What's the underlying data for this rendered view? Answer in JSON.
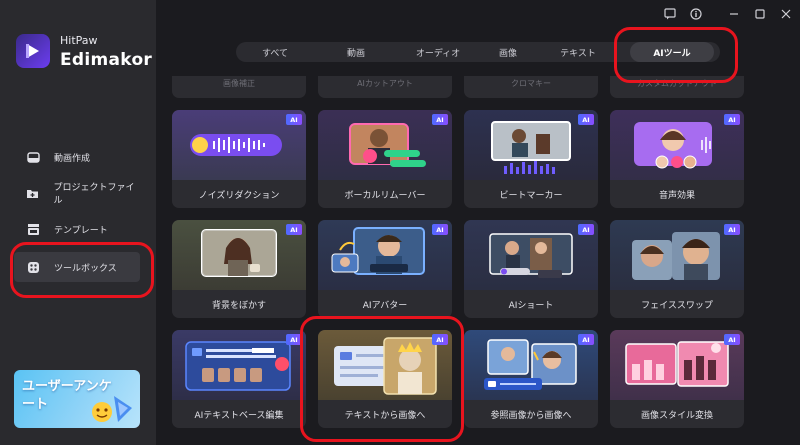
{
  "brand": {
    "line1": "HitPaw",
    "line2": "Edimakor"
  },
  "sidebar": {
    "items": [
      {
        "label": "動画作成",
        "icon": "home-icon"
      },
      {
        "label": "プロジェクトファイル",
        "icon": "folder-icon"
      },
      {
        "label": "テンプレート",
        "icon": "template-icon"
      },
      {
        "label": "ツールボックス",
        "icon": "toolbox-icon",
        "active": true
      }
    ],
    "promo": {
      "text": "ユーザーアンケート"
    }
  },
  "tabs": [
    {
      "label": "すべて"
    },
    {
      "label": "動画"
    },
    {
      "label": "オーディオ"
    },
    {
      "label": "画像"
    },
    {
      "label": "テキスト"
    },
    {
      "label": "AIツール",
      "active": true
    }
  ],
  "partial_row": [
    {
      "label": "画像補正"
    },
    {
      "label": "AIカットアウト"
    },
    {
      "label": "クロマキー"
    },
    {
      "label": "カスタムカットアウト"
    }
  ],
  "tools": [
    {
      "label": "ノイズリダクション",
      "badge": "AI"
    },
    {
      "label": "ボーカルリムーバー",
      "badge": "AI"
    },
    {
      "label": "ビートマーカー",
      "badge": "AI"
    },
    {
      "label": "音声効果",
      "badge": "AI"
    },
    {
      "label": "背景をぼかす",
      "badge": "AI"
    },
    {
      "label": "AIアバター",
      "badge": "AI"
    },
    {
      "label": "AIショート",
      "badge": "AI"
    },
    {
      "label": "フェイススワップ",
      "badge": "AI"
    },
    {
      "label": "AIテキストベース編集",
      "badge": "AI"
    },
    {
      "label": "テキストから画像へ",
      "badge": "AI"
    },
    {
      "label": "参照画像から画像へ",
      "badge": "AI"
    },
    {
      "label": "画像スタイル変換",
      "badge": "AI"
    }
  ],
  "colors": {
    "accent": "#6c3df0",
    "highlight": "#e8141e",
    "badge": "#5a5cff"
  }
}
